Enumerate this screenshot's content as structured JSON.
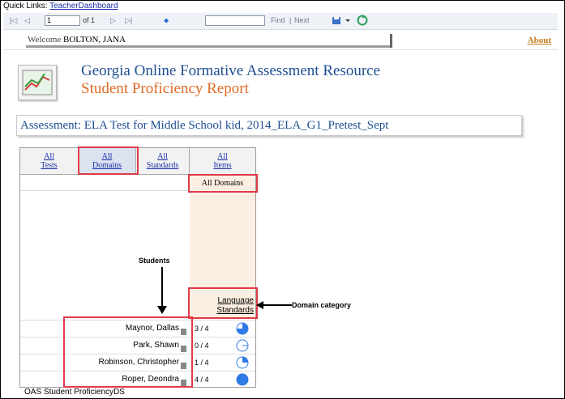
{
  "quick_links": {
    "prefix": "Quick Links: ",
    "link": "TeacherDashboard"
  },
  "toolbar": {
    "first": "|◁",
    "prev": "◁",
    "page_value": "1",
    "page_of": "of 1",
    "next": "▷",
    "last": "▷|",
    "back": "⬥",
    "find": "Find",
    "sep": "|",
    "next_label": "Next"
  },
  "welcome": {
    "label": "Welcome",
    "user": "BOLTON, JANA"
  },
  "about": "About",
  "title": {
    "line1": "Georgia Online Formative Assessment Resource",
    "line2": "Student Proficiency Report"
  },
  "assessment": "Assessment: ELA Test for Middle School kid, 2014_ELA_G1_Pretest_Sept",
  "nav": [
    {
      "l1": "All",
      "l2": "Tests"
    },
    {
      "l1": "All",
      "l2": "Domains"
    },
    {
      "l1": "All",
      "l2": "Standards"
    },
    {
      "l1": "All",
      "l2": "Items"
    }
  ],
  "domain_header": "All Domains",
  "domain_category": {
    "l1": "Language",
    "l2": "Standards"
  },
  "students_label": "Students",
  "domain_annotation": "Domain category",
  "students": [
    {
      "name": "Maynor, Dallas",
      "score": "3 / 4",
      "fraction": 0.75
    },
    {
      "name": "Park, Shawn",
      "score": "0 / 4",
      "fraction": 0
    },
    {
      "name": "Robinson, Christopher",
      "score": "1 / 4",
      "fraction": 0.25
    },
    {
      "name": "Roper, Deondra",
      "score": "4 / 4",
      "fraction": 1
    }
  ],
  "footer": "OAS Student ProficiencyDS",
  "colors": {
    "accent_blue": "#1f4f93",
    "orange": "#e06a23",
    "pie": "#2f7be6",
    "highlight": "#e03a47"
  }
}
